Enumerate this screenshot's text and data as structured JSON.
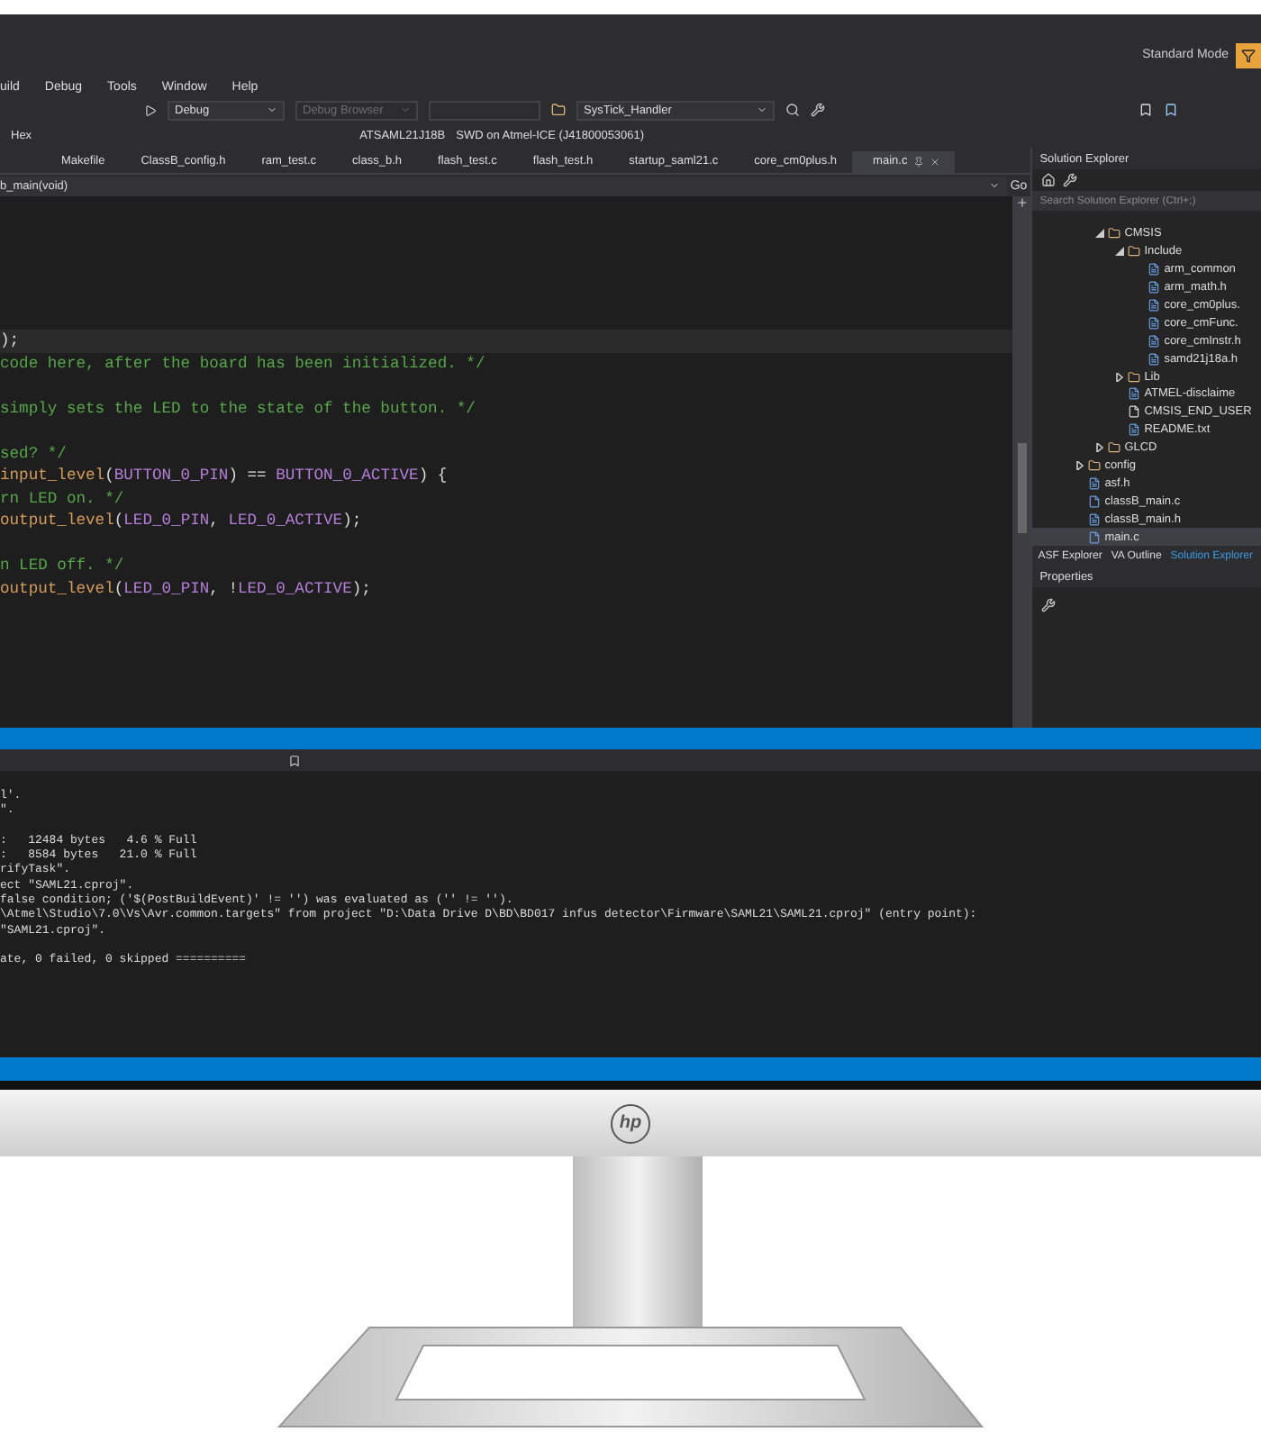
{
  "title_bar": {
    "mode": "Standard Mode"
  },
  "menu": [
    "uild",
    "Debug",
    "Tools",
    "Window",
    "Help"
  ],
  "toolbar": {
    "configuration": "Debug",
    "browser": "Debug Browser",
    "function": "SysTick_Handler",
    "hex": "Hex",
    "device": "ATSAML21J18B",
    "tool": "SWD on Atmel-ICE (J41800053061)"
  },
  "tabs": [
    {
      "label": "Makefile",
      "selected": false
    },
    {
      "label": "ClassB_config.h",
      "selected": false
    },
    {
      "label": "ram_test.c",
      "selected": false
    },
    {
      "label": "class_b.h",
      "selected": false
    },
    {
      "label": "flash_test.c",
      "selected": false
    },
    {
      "label": "flash_test.h",
      "selected": false
    },
    {
      "label": "startup_saml21.c",
      "selected": false
    },
    {
      "label": "core_cm0plus.h",
      "selected": false
    },
    {
      "label": "main.c",
      "selected": true
    }
  ],
  "editor": {
    "scope": "b_main(void)",
    "go": "Go",
    "blocks": [
      [
        {
          "current": true,
          "segments": [
            {
              "text": ");",
              "kind": "plain"
            }
          ]
        },
        {
          "current": false,
          "segments": [
            {
              "text": "code here, after the board has been initialized. */",
              "kind": "comment"
            }
          ]
        }
      ],
      [
        {
          "current": false,
          "segments": [
            {
              "text": "simply sets the LED to the state of the button. */",
              "kind": "comment"
            }
          ]
        }
      ],
      [
        {
          "current": false,
          "segments": [
            {
              "text": "sed? */",
              "kind": "comment"
            }
          ]
        },
        {
          "current": false,
          "segments": [
            {
              "text": "input_level",
              "kind": "func"
            },
            {
              "text": "(",
              "kind": "plain"
            },
            {
              "text": "BUTTON_0_PIN",
              "kind": "macro"
            },
            {
              "text": ") == ",
              "kind": "plain"
            },
            {
              "text": "BUTTON_0_ACTIVE",
              "kind": "macro"
            },
            {
              "text": ") {",
              "kind": "plain"
            }
          ]
        },
        {
          "current": false,
          "segments": [
            {
              "text": "rn LED on. */",
              "kind": "comment"
            }
          ]
        },
        {
          "current": false,
          "segments": [
            {
              "text": "output_level",
              "kind": "func"
            },
            {
              "text": "(",
              "kind": "plain"
            },
            {
              "text": "LED_0_PIN",
              "kind": "macro"
            },
            {
              "text": ", ",
              "kind": "plain"
            },
            {
              "text": "LED_0_ACTIVE",
              "kind": "macro"
            },
            {
              "text": ");",
              "kind": "plain"
            }
          ]
        }
      ],
      [
        {
          "current": false,
          "segments": [
            {
              "text": "n LED off. */",
              "kind": "comment"
            }
          ]
        },
        {
          "current": false,
          "segments": [
            {
              "text": "output_level",
              "kind": "func"
            },
            {
              "text": "(",
              "kind": "plain"
            },
            {
              "text": "LED_0_PIN",
              "kind": "macro"
            },
            {
              "text": ", !",
              "kind": "plain"
            },
            {
              "text": "LED_0_ACTIVE",
              "kind": "macro"
            },
            {
              "text": ");",
              "kind": "plain"
            }
          ]
        }
      ]
    ]
  },
  "solution_explorer": {
    "title": "Solution Explorer",
    "search": {
      "placeholder": "Search Solution Explorer (Ctrl+;)"
    },
    "tree": [
      {
        "children": [
          {
            "label": "CMSIS",
            "kind": "folder",
            "expanded": true,
            "selected": false,
            "children": [
              {
                "label": "Include",
                "kind": "folder",
                "expanded": true,
                "selected": false,
                "children": [
                  {
                    "label": "arm_common",
                    "kind": "header",
                    "selected": false
                  },
                  {
                    "label": "arm_math.h",
                    "kind": "header",
                    "selected": false
                  },
                  {
                    "label": "core_cm0plus.",
                    "kind": "header",
                    "selected": false
                  },
                  {
                    "label": "core_cmFunc.",
                    "kind": "header",
                    "selected": false
                  },
                  {
                    "label": "core_cmInstr.h",
                    "kind": "header",
                    "selected": false
                  },
                  {
                    "label": "samd21j18a.h",
                    "kind": "header",
                    "selected": false
                  }
                ]
              },
              {
                "label": "Lib",
                "kind": "folder",
                "expanded": false,
                "selected": false
              },
              {
                "label": "ATMEL-disclaime",
                "kind": "header",
                "selected": false
              },
              {
                "label": "CMSIS_END_USER",
                "kind": "text",
                "selected": false
              },
              {
                "label": "README.txt",
                "kind": "header",
                "selected": false
              }
            ]
          },
          {
            "label": "GLCD",
            "kind": "folder",
            "expanded": false,
            "selected": false
          }
        ]
      },
      {
        "label": "config",
        "kind": "folder",
        "expanded": false,
        "selected": false
      },
      {
        "label": "asf.h",
        "kind": "header",
        "selected": false
      },
      {
        "label": "classB_main.c",
        "kind": "source",
        "selected": false
      },
      {
        "label": "classB_main.h",
        "kind": "header",
        "selected": false
      },
      {
        "label": "main.c",
        "kind": "source",
        "selected": true
      }
    ],
    "tabs": [
      {
        "label": "ASF Explorer",
        "selected": false
      },
      {
        "label": "VA Outline",
        "selected": false
      },
      {
        "label": "Solution Explorer",
        "selected": true
      }
    ]
  },
  "properties": {
    "title": "Properties"
  },
  "output": {
    "blocks": [
      [
        "l'.",
        "\"."
      ],
      [
        ":   12484 bytes   4.6 % Full",
        ":   8584 bytes   21.0 % Full",
        "rifyTask\".",
        "ect \"SAML21.cproj\".",
        "false condition; ('$(PostBuildEvent)' != '') was evaluated as ('' != '').",
        "\\Atmel\\Studio\\7.0\\Vs\\Avr.common.targets\" from project \"D:\\Data Drive D\\BD\\BD017 infus detector\\Firmware\\SAML21\\SAML21.cproj\" (entry point):",
        "\"SAML21.cproj\"."
      ],
      [
        "ate, 0 failed, 0 skipped =========="
      ]
    ]
  },
  "bezel": {
    "logo": "hp"
  }
}
